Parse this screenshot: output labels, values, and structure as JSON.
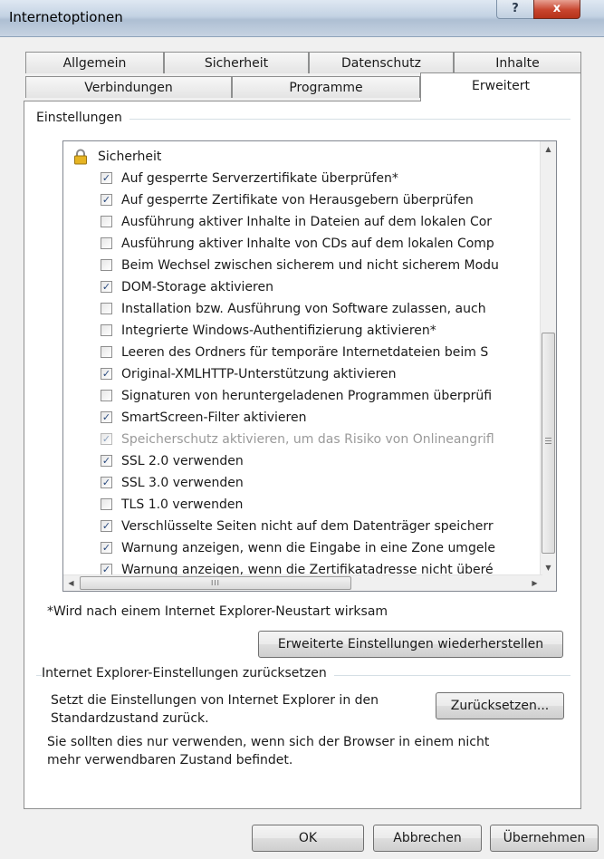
{
  "window": {
    "title": "Internetoptionen",
    "help_label": "?",
    "close_label": "x"
  },
  "tabs": {
    "row_back": [
      "Allgemein",
      "Sicherheit",
      "Datenschutz",
      "Inhalte"
    ],
    "row_front": [
      "Verbindungen",
      "Programme",
      "Erweitert"
    ],
    "active": "Erweitert"
  },
  "settings": {
    "group_label": "Einstellungen",
    "category": "Sicherheit",
    "items": [
      {
        "label": "Auf gesperrte Serverzertifikate überprüfen*",
        "checked": true,
        "enabled": true
      },
      {
        "label": "Auf gesperrte Zertifikate von Herausgebern überprüfen",
        "checked": true,
        "enabled": true
      },
      {
        "label": "Ausführung aktiver Inhalte in Dateien auf dem lokalen Cor",
        "checked": false,
        "enabled": true
      },
      {
        "label": "Ausführung aktiver Inhalte von CDs auf dem lokalen Comp",
        "checked": false,
        "enabled": true
      },
      {
        "label": "Beim Wechsel zwischen sicherem und nicht sicherem Modu",
        "checked": false,
        "enabled": true
      },
      {
        "label": "DOM-Storage aktivieren",
        "checked": true,
        "enabled": true
      },
      {
        "label": "Installation bzw. Ausführung von Software zulassen, auch",
        "checked": false,
        "enabled": true
      },
      {
        "label": "Integrierte Windows-Authentifizierung aktivieren*",
        "checked": false,
        "enabled": true
      },
      {
        "label": "Leeren des Ordners für temporäre Internetdateien beim S",
        "checked": false,
        "enabled": true
      },
      {
        "label": "Original-XMLHTTP-Unterstützung aktivieren",
        "checked": true,
        "enabled": true
      },
      {
        "label": "Signaturen von heruntergeladenen Programmen überprüfi",
        "checked": false,
        "enabled": true
      },
      {
        "label": "SmartScreen-Filter aktivieren",
        "checked": true,
        "enabled": true
      },
      {
        "label": "Speicherschutz aktivieren, um das Risiko von Onlineangrifl",
        "checked": true,
        "enabled": false
      },
      {
        "label": "SSL 2.0 verwenden",
        "checked": true,
        "enabled": true
      },
      {
        "label": "SSL 3.0 verwenden",
        "checked": true,
        "enabled": true
      },
      {
        "label": "TLS 1.0 verwenden",
        "checked": false,
        "enabled": true
      },
      {
        "label": "Verschlüsselte Seiten nicht auf dem Datenträger speicherr",
        "checked": true,
        "enabled": true
      },
      {
        "label": "Warnung anzeigen, wenn die Eingabe in eine Zone umgele",
        "checked": true,
        "enabled": true
      },
      {
        "label": "Warnung anzeigen, wenn die Zertifikatadresse nicht überé",
        "checked": true,
        "enabled": true
      }
    ],
    "restart_note": "*Wird nach einem Internet Explorer-Neustart wirksam",
    "restore_button": "Erweiterte Einstellungen wiederherstellen",
    "hscroll_grip": "III"
  },
  "reset": {
    "group_label": "Internet Explorer-Einstellungen zurücksetzen",
    "description_line1": "Setzt die Einstellungen von Internet Explorer in den",
    "description_line2": "Standardzustand zurück.",
    "reset_button": "Zurücksetzen...",
    "warning_line1": "Sie sollten dies nur verwenden, wenn sich der Browser in einem nicht",
    "warning_line2": "mehr verwendbaren Zustand befindet."
  },
  "footer": {
    "ok": "OK",
    "cancel": "Abbrechen",
    "apply": "Übernehmen"
  }
}
